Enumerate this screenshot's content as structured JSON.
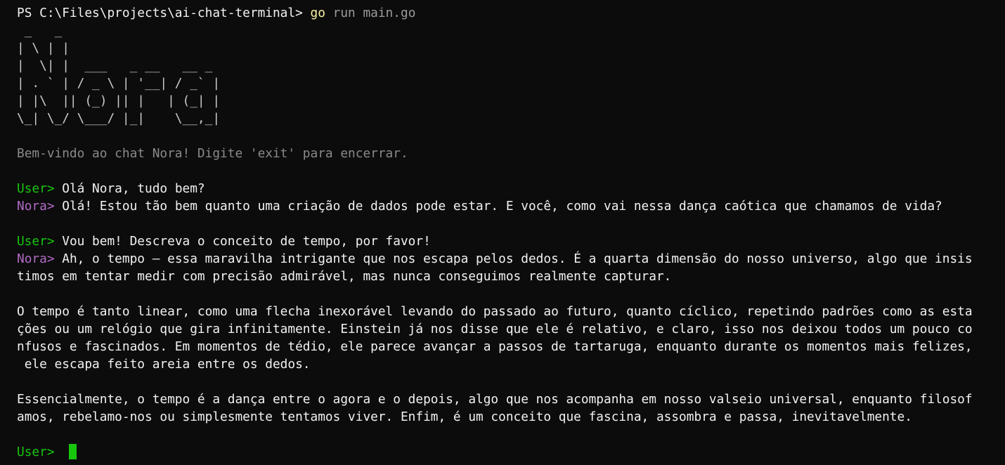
{
  "terminal": {
    "command_line": {
      "prompt": "PS C:\\Files\\projects\\ai-chat-terminal> ",
      "command": "go",
      "args": " run main.go"
    },
    "logo_ascii": " _   _\n| \\ | |\n|  \\| |  ___   _ __   __ _\n| . ` | / _ \\ | '__| / _` |\n| |\\  || (_) || |   | (_| |\n\\_| \\_/ \\___/ |_|    \\__,_|",
    "welcome": "Bem-vindo ao chat Nora! Digite 'exit' para encerrar.",
    "user_label": "User> ",
    "nora_label": "Nora> ",
    "messages": [
      {
        "text": "Olá Nora, tudo bem?"
      },
      {
        "text": "Olá! Estou tão bem quanto uma criação de dados pode estar. E você, como vai nessa dança caótica que chamamos de vida?"
      },
      {
        "text": "Vou bem! Descreva o conceito de tempo, por favor!"
      },
      {
        "lines": [
          "Ah, o tempo — essa maravilha intrigante que nos escapa pelos dedos. É a quarta dimensão do nosso universo, algo que insis",
          "timos em tentar medir com precisão admirável, mas nunca conseguimos realmente capturar.",
          "",
          "O tempo é tanto linear, como uma flecha inexorável levando do passado ao futuro, quanto cíclico, repetindo padrões como as esta",
          "ções ou um relógio que gira infinitamente. Einstein já nos disse que ele é relativo, e claro, isso nos deixou todos um pouco co",
          "nfusos e fascinados. Em momentos de tédio, ele parece avançar a passos de tartaruga, enquanto durante os momentos mais felizes,",
          " ele escapa feito areia entre os dedos.",
          "",
          "Essencialmente, o tempo é a dança entre o agora e o depois, algo que nos acompanha em nosso valseio universal, enquanto filosof",
          "amos, rebelamo-nos ou simplesmente tentamos viver. Enfim, é um conceito que fascina, assombra e passa, inevitavelmente."
        ]
      }
    ],
    "colors": {
      "background": "#0c0c0c",
      "user_prompt": "#16c60c",
      "nora_prompt": "#b26bc5",
      "text": "#f2f2f2",
      "muted": "#8a8a8a",
      "command": "#f9f1a5"
    }
  }
}
